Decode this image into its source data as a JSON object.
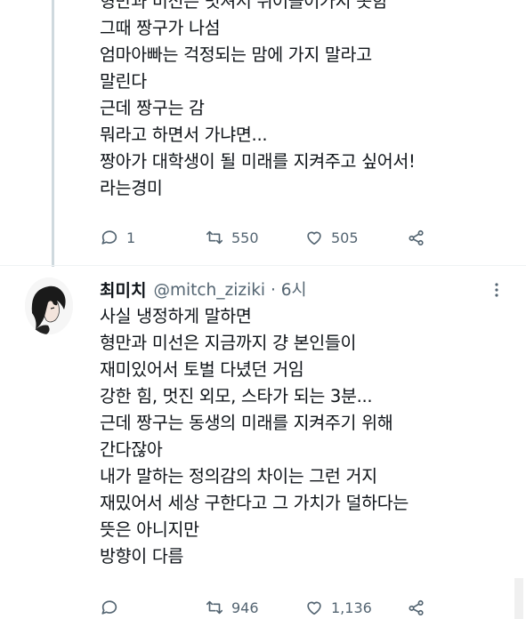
{
  "tweet1": {
    "lines": [
      "형만과 미선은 멋져서 뛰어들어가지 못함",
      "그때 짱구가 나섬",
      "엄마아빠는 걱정되는 맘에   가지 말라고",
      "말린다",
      "근데 짱구는 감",
      "뭐라고 하면서 가냐면...",
      "짱아가 대학생이 될 미래를 지켜주고 싶어서!",
      "라는경미"
    ],
    "actions": {
      "replies": "1",
      "retweets": "550",
      "likes": "505"
    }
  },
  "tweet2": {
    "author_name": "최미치",
    "handle_time": "@mitch_ziziki · 6시",
    "lines": [
      "사실 냉정하게 말하면",
      "형만과 미선은 지금까지 걍 본인들이",
      "재미있어서 토벌 다녔던 거임",
      "강한 힘, 멋진 외모, 스타가 되는 3분...",
      "근데 짱구는 동생의 미래를 지켜주기 위해",
      "간다잖아",
      "내가 말하는 정의감의 차이는 그런 거지",
      "재밌어서 세상 구한다고 그 가치가 덜하다는",
      "뜻은 아니지만",
      "방향이 다름"
    ],
    "actions": {
      "replies": "",
      "retweets": "946",
      "likes": "1,136"
    }
  },
  "icons": {
    "reply": "speech-bubble-icon",
    "retweet": "retweet-icon",
    "like": "heart-icon",
    "share": "share-icon",
    "more": "more-dots-icon"
  },
  "colors": {
    "text": "#0f1419",
    "secondary": "#536471",
    "thread_line": "#cfd9de"
  }
}
